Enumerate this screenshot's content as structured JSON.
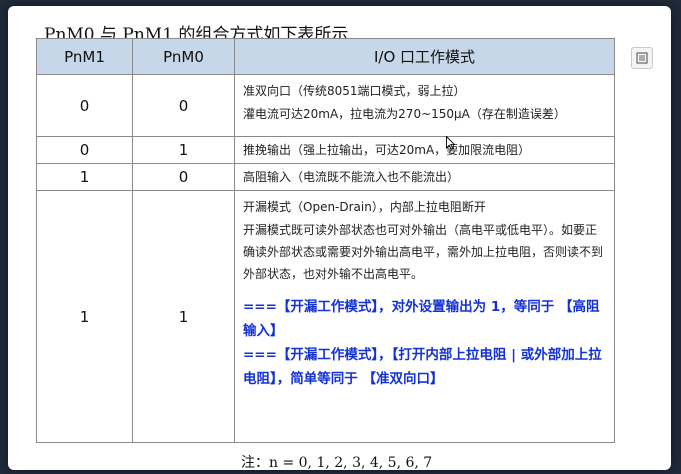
{
  "title": "PnM0 与 PnM1 的组合方式如下表所示",
  "headers": [
    "PnM1",
    "PnM0",
    "I/O 口工作模式"
  ],
  "rows": [
    {
      "pnm1": "0",
      "pnm0": "0",
      "lines": [
        "准双向口（传统8051端口模式，弱上拉）",
        "灌电流可达20mA，拉电流为270~150μA（存在制造误差）"
      ]
    },
    {
      "pnm1": "0",
      "pnm0": "1",
      "lines": [
        "推挽输出（强上拉输出，可达20mA，要加限流电阻）"
      ]
    },
    {
      "pnm1": "1",
      "pnm0": "0",
      "lines": [
        "高阻输入（电流既不能流入也不能流出）"
      ]
    },
    {
      "pnm1": "1",
      "pnm0": "1",
      "lines": [
        "开漏模式（Open-Drain），内部上拉电阻断开",
        "开漏模式既可读外部状态也可对外输出（高电平或低电平）。如要正确读外部状态或需要对外输出高电平，需外加上拉电阻，否则读不到外部状态，也对外输不出高电平。"
      ],
      "notes": [
        "===【开漏工作模式】，对外设置输出为 1，等同于 【高阻输入】",
        "===【开漏工作模式】，【打开内部上拉电阻 | 或外部加上拉电阻】，简单等同于 【准双向口】"
      ],
      "notes_color": "#1432d4"
    }
  ],
  "footnote": "注：n = 0, 1, 2, 3, 4, 5, 6, 7",
  "icons": {
    "side_tool": "fullscreen-icon",
    "cursor": "mouse-cursor-icon"
  }
}
